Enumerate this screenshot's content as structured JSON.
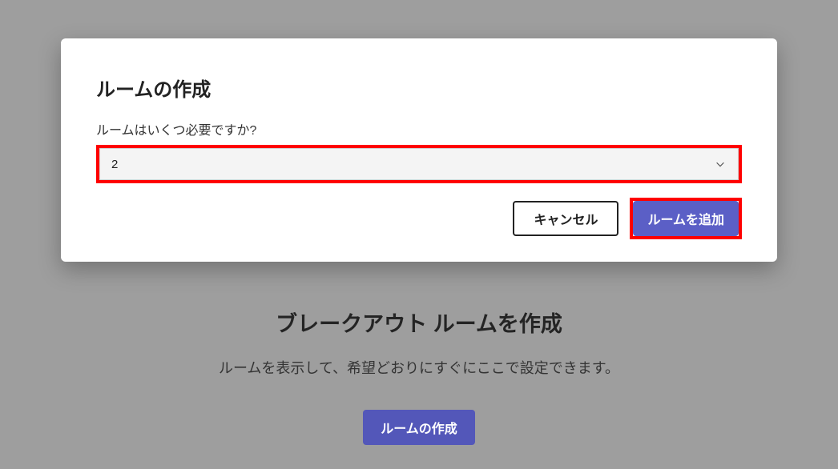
{
  "background": {
    "heading": "ブレークアウト ルームを作成",
    "subtext": "ルームを表示して、希望どおりにすぐにここで設定できます。",
    "button_label": "ルームの作成"
  },
  "modal": {
    "title": "ルームの作成",
    "label": "ルームはいくつ必要ですか?",
    "select_value": "2",
    "cancel_label": "キャンセル",
    "add_label": "ルームを追加"
  },
  "colors": {
    "primary": "#5b5fc6",
    "highlight": "#ff0000"
  }
}
